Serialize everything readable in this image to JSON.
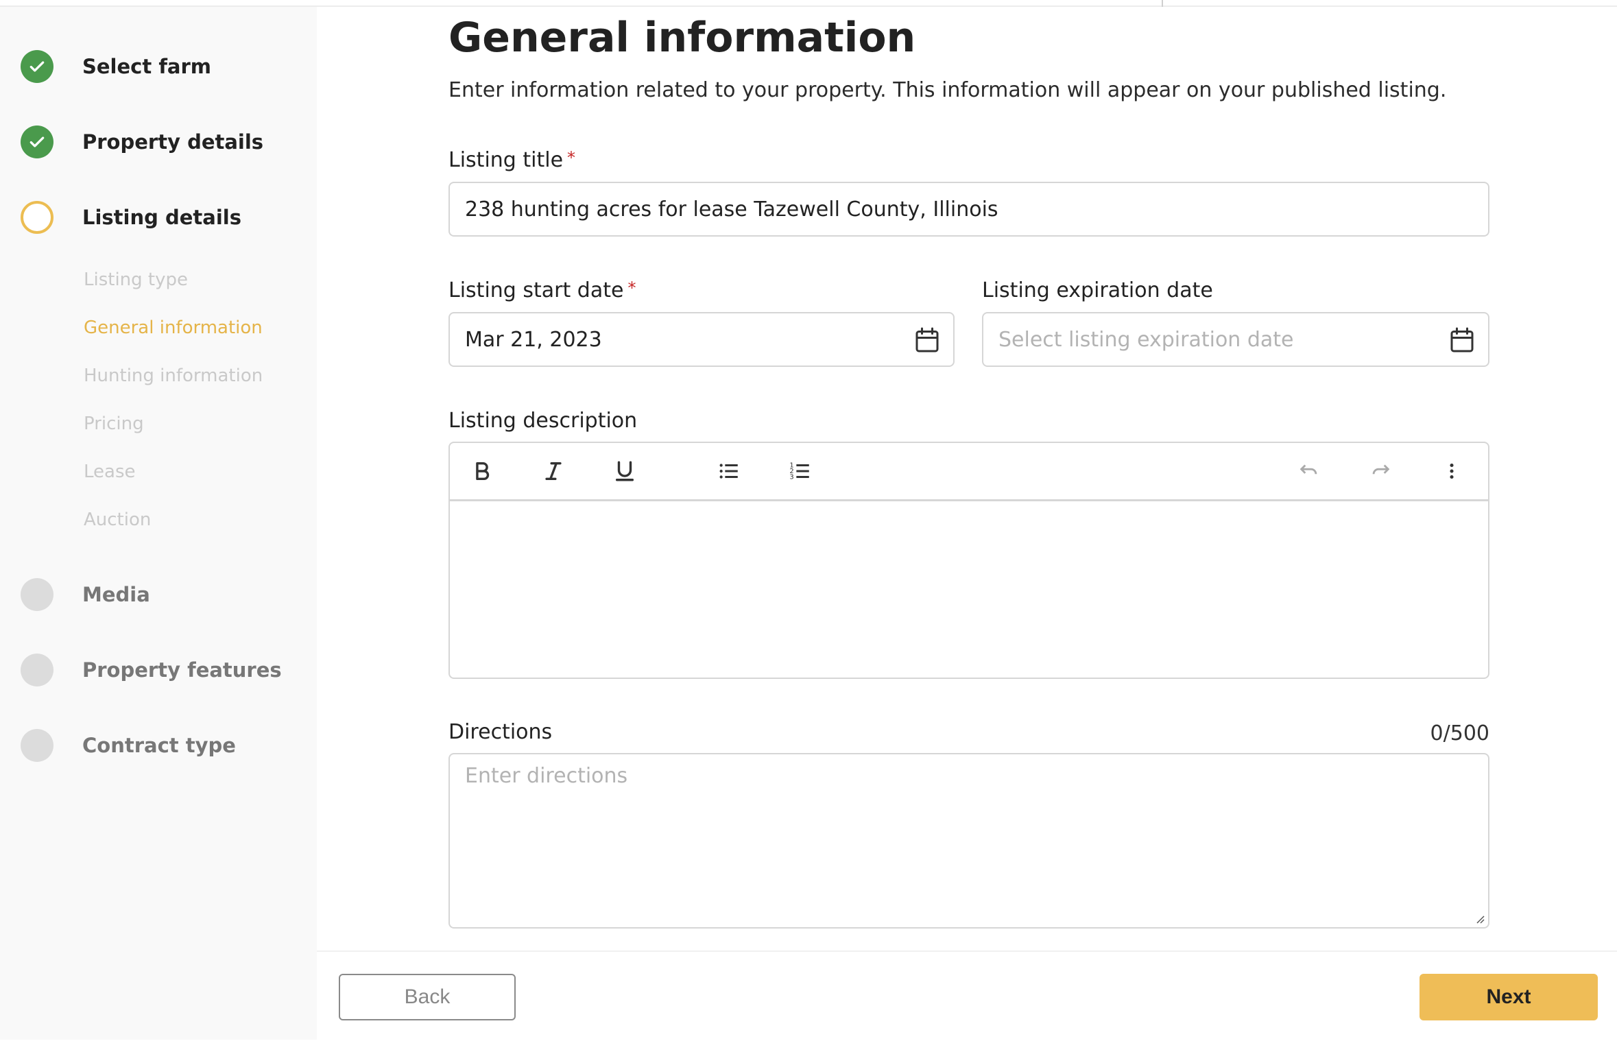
{
  "steps": [
    {
      "label": "Select farm",
      "status": "done"
    },
    {
      "label": "Property details",
      "status": "done"
    },
    {
      "label": "Listing details",
      "status": "current"
    },
    {
      "label": "Media",
      "status": "pending"
    },
    {
      "label": "Property features",
      "status": "pending"
    },
    {
      "label": "Contract type",
      "status": "pending"
    }
  ],
  "substeps": [
    {
      "label": "Listing type"
    },
    {
      "label": "General information",
      "active": true
    },
    {
      "label": "Hunting information"
    },
    {
      "label": "Pricing"
    },
    {
      "label": "Lease"
    },
    {
      "label": "Auction"
    }
  ],
  "main": {
    "title": "General information",
    "subtitle": "Enter information related to your property. This information will appear on your published listing."
  },
  "form": {
    "listing_title": {
      "label": "Listing title",
      "required_mark": "*",
      "value": "238 hunting acres for lease Tazewell County, Illinois"
    },
    "start_date": {
      "label": "Listing start date",
      "required_mark": "*",
      "value": "Mar 21, 2023"
    },
    "expiration_date": {
      "label": "Listing expiration date",
      "placeholder": "Select listing expiration date"
    },
    "description": {
      "label": "Listing description"
    },
    "directions": {
      "label": "Directions",
      "counter": "0/500",
      "placeholder": "Enter directions"
    }
  },
  "toolbar_icons": [
    "bold-icon",
    "italic-icon",
    "underline-icon",
    "bulleted-list-icon",
    "numbered-list-icon",
    "undo-icon",
    "redo-icon",
    "more-vertical-icon"
  ],
  "footer": {
    "back_label": "Back",
    "next_label": "Next"
  },
  "colors": {
    "done": "#4a9a4c",
    "current": "#ecbd52",
    "accent": "#efbd57",
    "required": "#c62828"
  }
}
